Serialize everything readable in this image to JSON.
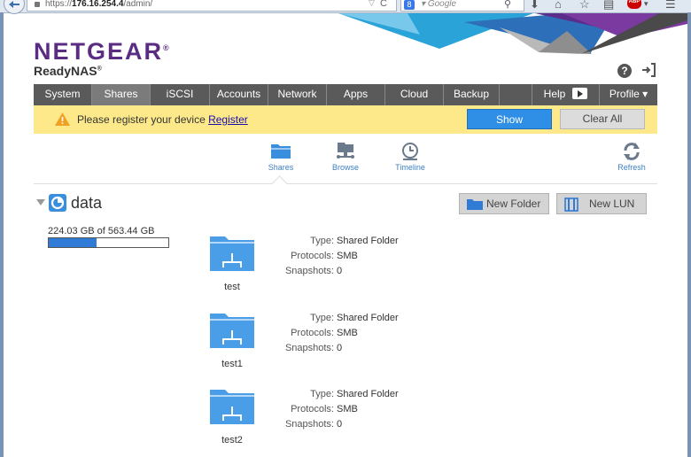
{
  "browser": {
    "url_prefix": "https://",
    "url_host": "176.16.254.4",
    "url_path": "/admin/",
    "search_placeholder": "Google",
    "search_engine_badge": "8",
    "icons": [
      "back-icon",
      "lock-icon",
      "reload-icon",
      "search-icon",
      "download-icon",
      "home-icon",
      "bookmark-star-icon",
      "reading-list-icon",
      "adblock-icon",
      "menu-icon"
    ]
  },
  "header": {
    "brand": "NETGEAR",
    "brand_mark": "®",
    "product": "ReadyNAS",
    "product_mark": "®",
    "icons": [
      "help-icon",
      "logout-icon"
    ]
  },
  "nav": {
    "items": [
      {
        "label": "System"
      },
      {
        "label": "Shares"
      },
      {
        "label": "iSCSI"
      },
      {
        "label": "Accounts"
      },
      {
        "label": "Network"
      },
      {
        "label": "Apps"
      },
      {
        "label": "Cloud"
      },
      {
        "label": "Backup"
      },
      {
        "label": ""
      },
      {
        "label": "Help"
      },
      {
        "label": "Profile ▾"
      }
    ],
    "active": "Shares"
  },
  "banner": {
    "text": "Please register your device ",
    "link": "Register",
    "show_label": "Show",
    "clear_label": "Clear All"
  },
  "toolbar": {
    "shares": "Shares",
    "browse": "Browse",
    "timeline": "Timeline",
    "refresh": "Refresh"
  },
  "volume": {
    "name": "data",
    "capacity": "224.03 GB of 563.44 GB",
    "used_fraction": 0.3976,
    "new_folder_label": "New Folder",
    "new_lun_label": "New LUN"
  },
  "shares": [
    {
      "name": "test",
      "type_label": "Type:",
      "type": "Shared Folder",
      "protocols_label": "Protocols:",
      "protocols": "SMB",
      "snapshots_label": "Snapshots:",
      "snapshots": "0"
    },
    {
      "name": "test1",
      "type_label": "Type:",
      "type": "Shared Folder",
      "protocols_label": "Protocols:",
      "protocols": "SMB",
      "snapshots_label": "Snapshots:",
      "snapshots": "0"
    },
    {
      "name": "test2",
      "type_label": "Type:",
      "type": "Shared Folder",
      "protocols_label": "Protocols:",
      "protocols": "SMB",
      "snapshots_label": "Snapshots:",
      "snapshots": "0"
    }
  ],
  "colors": {
    "brand_purple": "#5a2d83",
    "nav_bg": "#5a5a5a",
    "banner_yellow": "#fde98a",
    "accent_blue": "#2f8ee6",
    "folder_blue": "#4a9ee8"
  }
}
